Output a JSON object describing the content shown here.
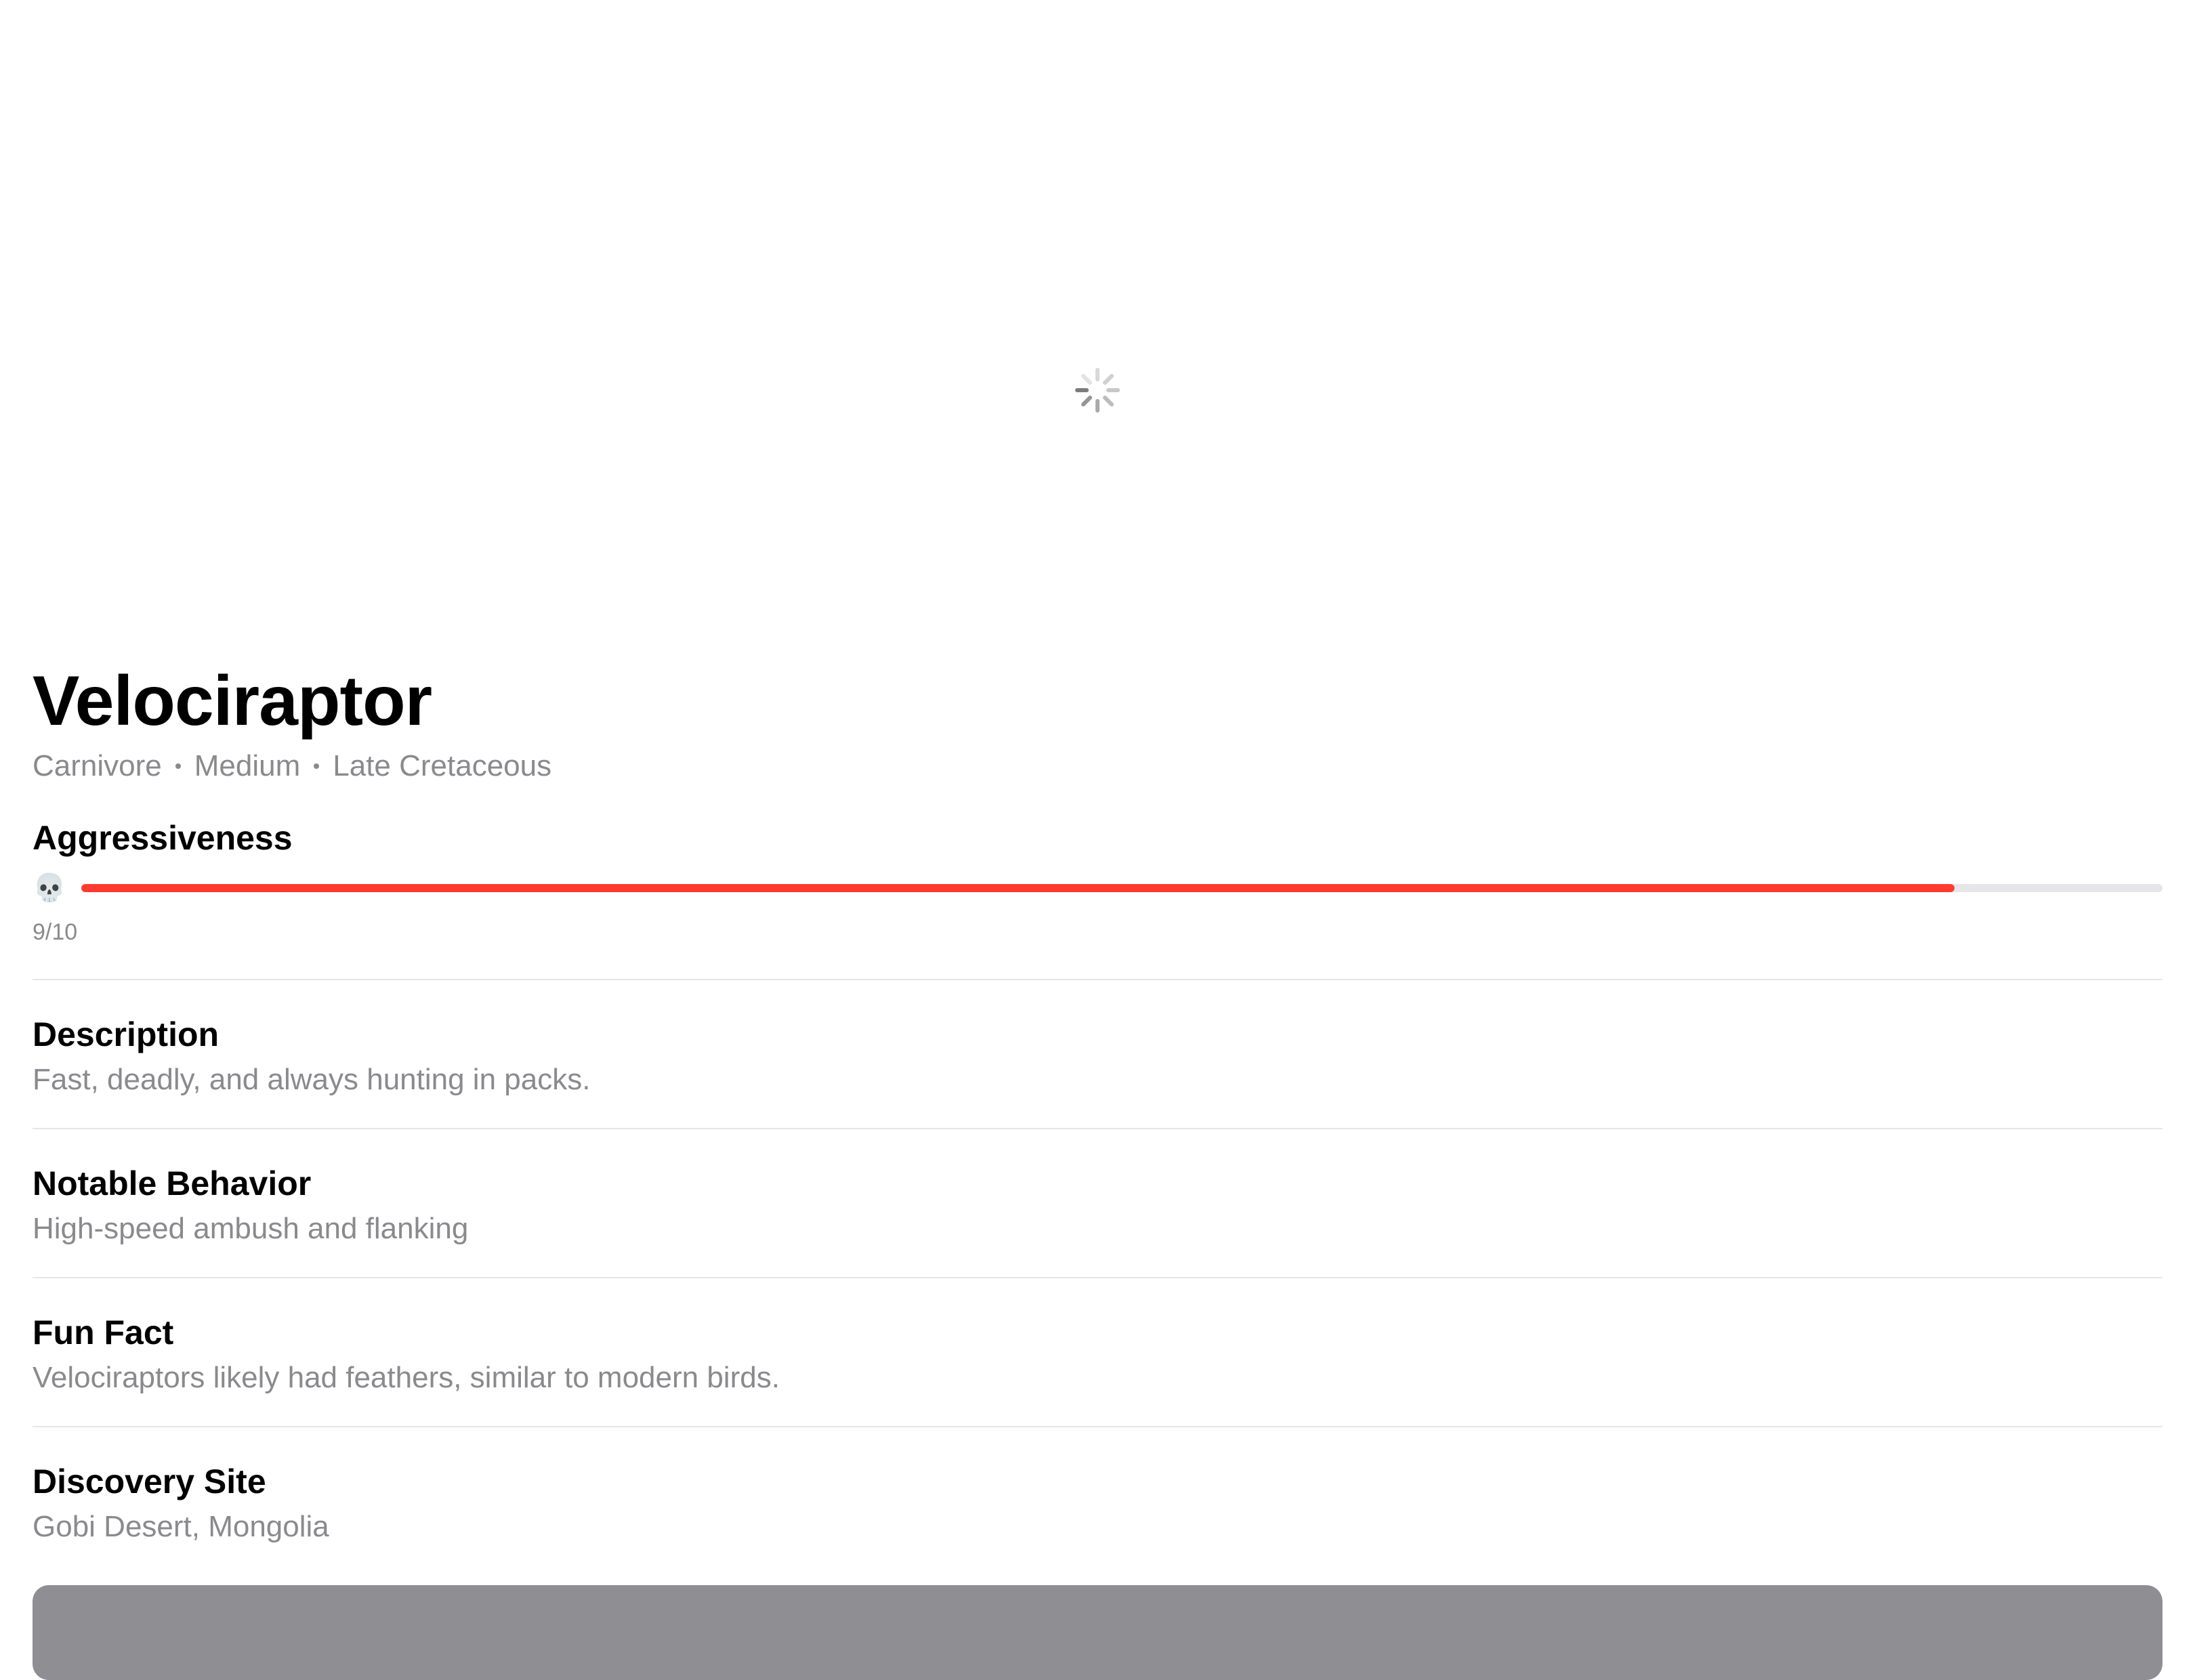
{
  "header": {
    "loading_icon": "activity-spinner"
  },
  "dino": {
    "name": "Velociraptor",
    "diet": "Carnivore",
    "size": "Medium",
    "period": "Late Cretaceous"
  },
  "aggressiveness": {
    "label": "Aggressiveness",
    "icon": "skull-icon",
    "icon_glyph": "💀",
    "score_text": "9/10",
    "level_fraction": 0.9,
    "bar_color": "#ff3b30",
    "track_color": "#e5e5ea"
  },
  "sections": [
    {
      "title": "Description",
      "value": "Fast, deadly, and always hunting in packs."
    },
    {
      "title": "Notable Behavior",
      "value": "High-speed ambush and flanking"
    },
    {
      "title": "Fun Fact",
      "value": "Velociraptors likely had feathers, similar to modern birds."
    },
    {
      "title": "Discovery Site",
      "value": "Gobi Desert, Mongolia"
    }
  ]
}
